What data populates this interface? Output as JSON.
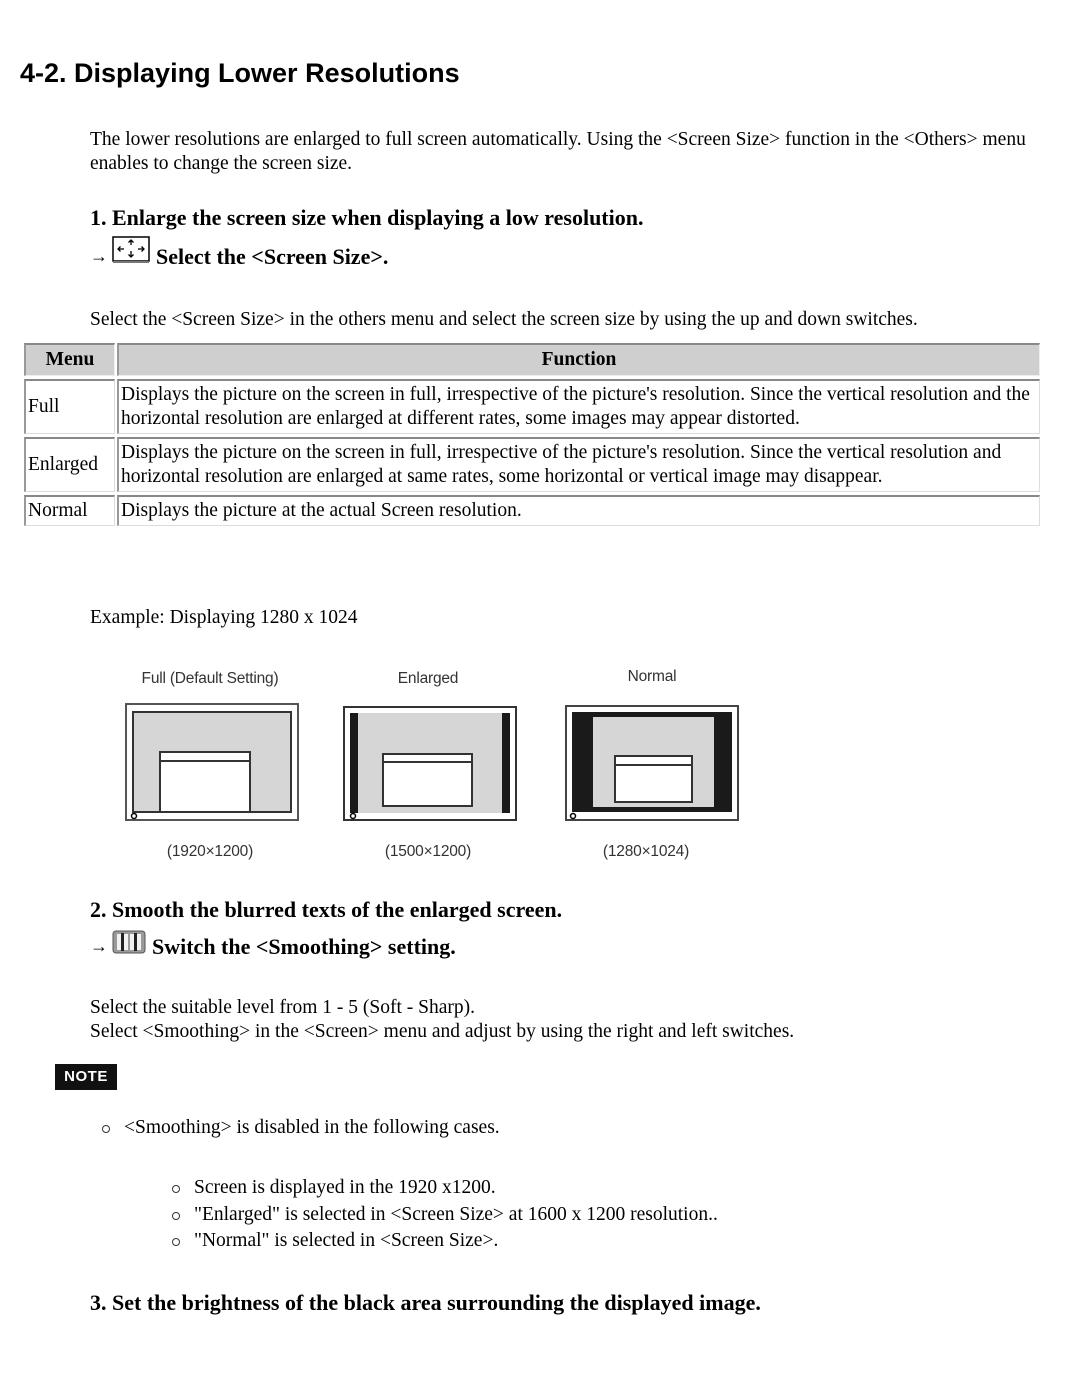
{
  "page_title": "4-2. Displaying Lower Resolutions",
  "intro": "The lower resolutions are enlarged to full screen automatically. Using the <Screen Size> function in the <Others> menu enables to change the screen size.",
  "section1": {
    "heading": "1. Enlarge the screen size when displaying a low resolution.",
    "arrow": "→",
    "icon": "screen-size-icon",
    "action": "Select the <Screen Size>.",
    "description": "Select the <Screen Size> in the others menu and select the screen size by using the up and down switches.",
    "table": {
      "headers": [
        "Menu",
        "Function"
      ],
      "rows": [
        {
          "menu": "Full",
          "function": "Displays the picture on the screen in full, irrespective of the picture's resolution. Since the vertical resolution and the horizontal resolution are enlarged at different rates, some images may appear distorted."
        },
        {
          "menu": "Enlarged",
          "function": "Displays the picture on the screen in full, irrespective of the picture's resolution. Since the vertical resolution and horizontal resolution are enlarged at same rates, some horizontal or vertical image may disappear."
        },
        {
          "menu": "Normal",
          "function": "Displays the picture at the actual Screen resolution."
        }
      ]
    },
    "example": "Example: Displaying 1280 x 1024",
    "diagrams": [
      {
        "label": "Full (Default Setting)",
        "resolution": "(1920×1200)",
        "mode": "full"
      },
      {
        "label": "Enlarged",
        "resolution": "(1500×1200)",
        "mode": "enlarged"
      },
      {
        "label": "Normal",
        "resolution": "(1280×1024)",
        "mode": "normal"
      }
    ]
  },
  "section2": {
    "heading": "2. Smooth the blurred texts of the enlarged screen.",
    "arrow": "→",
    "icon": "smoothing-icon",
    "action": "Switch the <Smoothing> setting.",
    "lines": [
      "Select the suitable level from 1 - 5 (Soft - Sharp).",
      "Select <Smoothing> in the <Screen> menu and adjust by using the right and left switches."
    ],
    "note_label": "NOTE",
    "note_item": "<Smoothing> is disabled in the following cases.",
    "cases": [
      "Screen is displayed in the 1920 x1200.",
      "\"Enlarged\" is selected in <Screen Size> at 1600 x 1200 resolution..",
      "\"Normal\" is selected in <Screen Size>."
    ]
  },
  "section3": {
    "heading": "3. Set the brightness of the black area surrounding the displayed image."
  }
}
